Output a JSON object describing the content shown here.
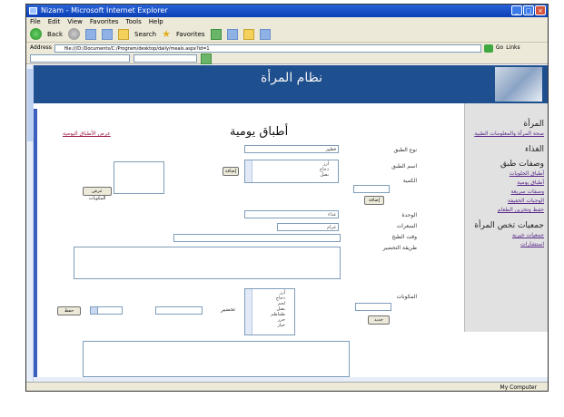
{
  "window": {
    "title": "Nizam - Microsoft Internet Explorer",
    "buttons": [
      "_",
      "□",
      "×"
    ]
  },
  "menu": [
    "File",
    "Edit",
    "View",
    "Favorites",
    "Tools",
    "Help"
  ],
  "toolbar": {
    "back": "Back",
    "search": "Search",
    "favorites": "Favorites"
  },
  "address": {
    "label": "Address",
    "value": "file:///D:/Documents/C:/Program/desktop/daily/meals.aspx?id=1",
    "go": "Go",
    "links": "Links"
  },
  "header": {
    "title": "نظام المرأة"
  },
  "sidebar": {
    "sections": [
      {
        "title": "المرأة",
        "links": [
          "صحة المرأة والمعلومات الطبية"
        ]
      },
      {
        "title": "الغذاء",
        "links": []
      },
      {
        "title": "وصفات طبق",
        "links": [
          "أطباق الحلويات",
          "أطباق يومية",
          "وصفات سريعة",
          "الوجبات الخفيفة",
          "حفظ وتخزين الطعام"
        ]
      },
      {
        "title": "جمعيات تخص المرأة",
        "links": [
          "جمعيات خيرية",
          "استشارات"
        ]
      }
    ]
  },
  "main": {
    "page_title": "أطباق يومية",
    "top_link": "عرض الأطباق اليومية",
    "labels": {
      "dish_type": "نوع الطبق",
      "dish_name": "اسم الطبق",
      "ingredients": "المكونات",
      "quantity": "الكمية",
      "unit": "الوحدة",
      "method": "طريقة التحضير",
      "calories": "السعرات",
      "cook_time": "وقت الطبخ",
      "preparation": "تحضير"
    },
    "selects": {
      "s1": "فطور",
      "s2": "غداء",
      "s3": "غرام"
    },
    "list1": [
      "أرز",
      "دجاج",
      "بصل"
    ],
    "list2": [
      "أرز",
      "دجاج",
      "لحم",
      "بصل",
      "طماطم",
      "جزر",
      "خيار"
    ],
    "buttons": {
      "add": "إضافة",
      "add2": "إضافة",
      "show": "عرض المكونات",
      "save": "حفظ",
      "new": "جديد"
    }
  },
  "status": {
    "zone": "My Computer"
  }
}
